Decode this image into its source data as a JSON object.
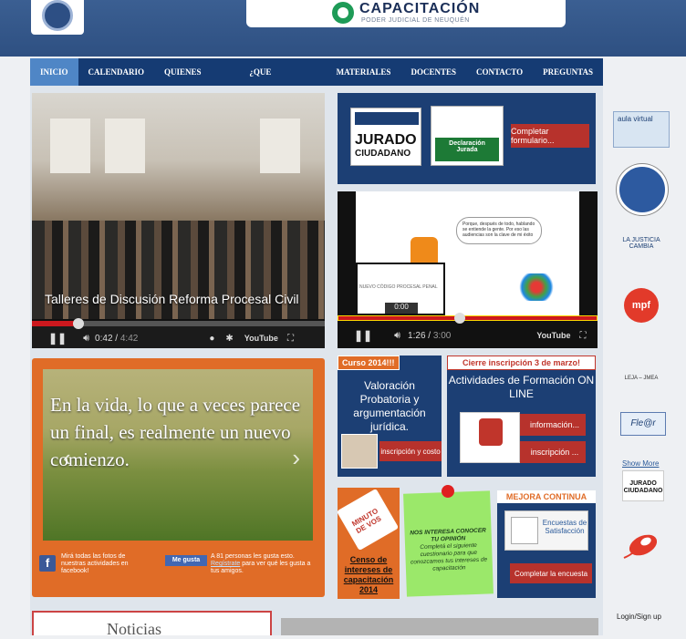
{
  "header": {
    "brand_title": "CAPACITACIÓN",
    "brand_subtitle": "PODER JUDICIAL DE NEUQUÉN"
  },
  "nav": {
    "items": [
      "INICIO",
      "CALENDARIO",
      "QUIENES SOMOS",
      "¿QUE HACEMOS?",
      "MATERIALES",
      "DOCENTES",
      "CONTACTO",
      "PREGUNTAS"
    ],
    "active": "INICIO"
  },
  "video1": {
    "title": "Talleres de Discusión Reforma Procesal Civil",
    "time_current": "0:42",
    "time_total": "4:42",
    "progress": 0.16,
    "youtube": "YouTube"
  },
  "jurado": {
    "logo_line1": "JURADO",
    "logo_line2": "CIUDADANO",
    "declaracion_line1": "Declaración",
    "declaracion_line2": "Jurada",
    "button": "Completar formulario..."
  },
  "video2": {
    "bubble_text": "Porque, después de todo, hablando se entiende la gente. Por eso las audiencias son la clave de mi éxito",
    "mini_title": "NUEVO CÓDIGO PROCESAL PENAL",
    "mini_time": "0:00",
    "time_current": "1:26",
    "time_total": "3:00",
    "progress": 0.47,
    "youtube": "YouTube"
  },
  "slider": {
    "quote": "En la vida, lo que a veces parece un final, es realmente un nuevo comienzo.",
    "prev": "‹",
    "next": "›",
    "fb_text": "Mirá todas las fotos de nuestras actividades en facebook!",
    "like_label": "Me gusta",
    "like_text_pre": "A 81 personas les gusta esto.",
    "like_text_link": "Regístrate",
    "like_text_post": "para ver qué les gusta a tus amigos."
  },
  "curso": {
    "tag": "Curso 2014!!!",
    "text": "Valoración Probatoria y argumentación jurídica.",
    "button": "inscripción y costo"
  },
  "activ": {
    "tag": "Cierre inscripción 3 de marzo!",
    "text": "Actividades de Formación ON LINE",
    "btn1": "información...",
    "btn2": "inscripción ..."
  },
  "censo": {
    "logo": "MINUTO DE VOS",
    "text": "Censo de intereses de capacitación 2014"
  },
  "note": {
    "heading": "NOS INTERESA CONOCER TU OPINIÓN",
    "text": "Completá el siguiente cuestionario para que conozcamos tus intereses de capacitación"
  },
  "mejora": {
    "tag": "MEJORA CONTINUA",
    "card": "Encuestas de Satisfacción",
    "button": "Completar la encuesta"
  },
  "bottom": {
    "noticias": "Noticias"
  },
  "sidebar": {
    "aula": "aula virtual",
    "justicia": "LA JUSTICIA CAMBIA",
    "mpf": "mpf",
    "aba": "LEJA – JMEA",
    "fle": "Fle@r",
    "show_more": "Show More",
    "jurado_line1": "JURADO",
    "jurado_line2": "CIUDADANO",
    "login": "Login/Sign up"
  },
  "colors": {
    "navy": "#1c3f74",
    "orange": "#e06c27",
    "red_button": "#b7322c",
    "nav_active": "#4f86c6"
  }
}
